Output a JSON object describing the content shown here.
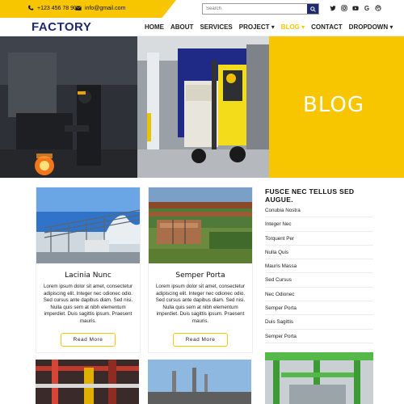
{
  "topbar": {
    "phone": "+123 456 78 90",
    "email": "info@gmail.com",
    "search_placeholder": "Search",
    "social_icons": [
      "twitter-icon",
      "instagram-icon",
      "youtube-icon",
      "google-icon",
      "dribbble-icon"
    ]
  },
  "header": {
    "logo": "FACTORY",
    "nav": [
      "HOME",
      "ABOUT",
      "SERVICES",
      "PROJECT ▾",
      "BLOG ▾",
      "CONTACT",
      "DROPDOWN ▾"
    ],
    "active": "BLOG ▾"
  },
  "hero": {
    "title": "BLOG"
  },
  "cards": [
    {
      "title": "Lacinia Nunc",
      "text": "Lorem ipsum dolor sit amet, consectetur adipiscing elit. Integer nec odionec odio. Sed cursus ante dapibus diam. Sed nisi. Nulla quis sem at nibh elementum imperdiet. Duis sagittis ipsum. Praesent mauris.",
      "button": "Read More"
    },
    {
      "title": "Semper Porta",
      "text": "Lorem ipsum dolor sit amet, consectetur adipiscing elit. Integer nec odionec odio. Sed cursus ante dapibus diam. Sed nisi. Nulla quis sem at nibh elementum imperdiet. Duis sagittis ipsum. Praesent mauris.",
      "button": "Read More"
    }
  ],
  "sidebar": {
    "title": "FUSCE NEC TELLUS SED AUGUE.",
    "items": [
      "Conubia Nostra",
      "Integer Nec",
      "Torquent Per",
      "Nulla Quis",
      "Mauris Massa",
      "Sed Cursus",
      "Nec Odionec",
      "Semper Porta",
      "Duis Sagittis",
      "Semper Porta"
    ]
  },
  "colors": {
    "accent": "#f7c600",
    "brand": "#1e2a6b"
  }
}
